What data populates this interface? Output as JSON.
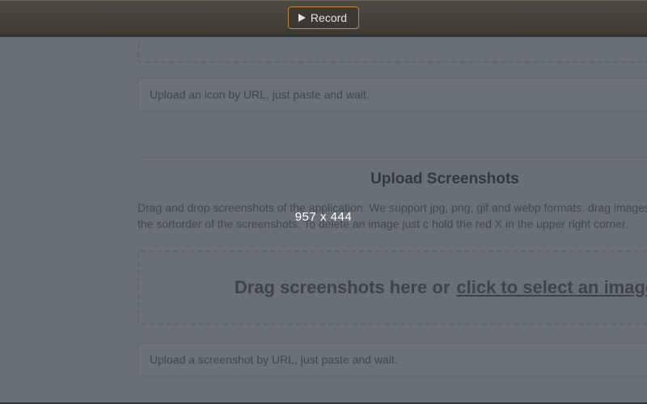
{
  "toolbar": {
    "record_label": "Record"
  },
  "icon_section": {
    "url_placeholder": "Upload an icon by URL, just paste and wait."
  },
  "screenshots_section": {
    "title": "Upload Screenshots",
    "description": "Drag and drop screenshots of the application. We support jpg, png, gif and webp formats. drag images around to change the sortorder of the screenshots. To delete an image just c hold the red X in the upper right corner.",
    "dropzone_prefix": "Drag screenshots here or",
    "dropzone_link": "click to select an image",
    "url_placeholder": "Upload a screenshot by URL, just paste and wait."
  },
  "overlay": {
    "dimensions_text": "957 x 444"
  }
}
